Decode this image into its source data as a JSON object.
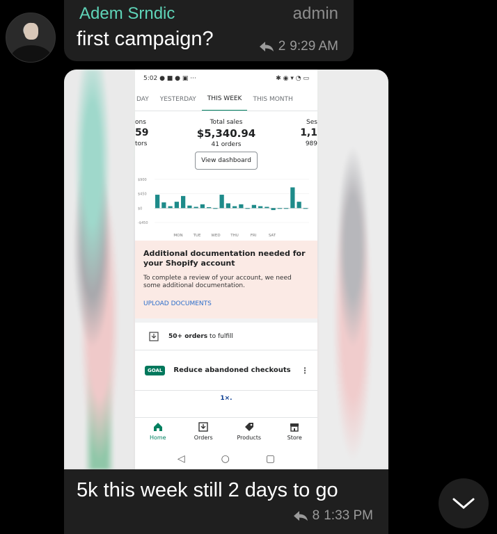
{
  "message1": {
    "sender": "Adem Srndic",
    "role": "admin",
    "text": "first campaign?",
    "reply_count": "2",
    "time": "9:29 AM"
  },
  "screenshot": {
    "status_time": "5:02",
    "tabs": [
      "DAY",
      "YESTERDAY",
      "THIS WEEK",
      "THIS MONTH"
    ],
    "active_tab": "THIS WEEK",
    "left_metric": {
      "label": "ons",
      "value": "59",
      "sub": "tors"
    },
    "total_sales": {
      "label": "Total sales",
      "value": "$5,340.94",
      "sub": "41 orders"
    },
    "right_metric": {
      "label": "Ses",
      "value": "1,1",
      "sub": "989"
    },
    "view_dashboard": "View dashboard",
    "chart_data": {
      "type": "bar",
      "y_ticks": [
        "$900",
        "$450",
        "$0",
        "-$450"
      ],
      "ylim": [
        -450,
        900
      ],
      "x_labels": [
        "MON",
        "TUE",
        "WED",
        "THU",
        "FRI",
        "SAT"
      ],
      "values": [
        420,
        180,
        60,
        200,
        380,
        80,
        40,
        120,
        30,
        0,
        420,
        150,
        60,
        120,
        0,
        100,
        60,
        40,
        -60,
        0,
        0,
        650,
        200,
        0
      ]
    },
    "notice": {
      "title": "Additional documentation needed for your Shopify account",
      "body": "To complete a review of your account, we need some additional documentation.",
      "link": "UPLOAD DOCUMENTS"
    },
    "orders_card": {
      "bold": "50+ orders",
      "rest": "to fulfill"
    },
    "goal": {
      "badge": "GOAL",
      "text": "Reduce abandoned checkouts",
      "more": "⋮"
    },
    "partial_text": "1×.",
    "nav": [
      {
        "label": "Home",
        "active": true
      },
      {
        "label": "Orders",
        "active": false
      },
      {
        "label": "Products",
        "active": false
      },
      {
        "label": "Store",
        "active": false
      }
    ]
  },
  "message2": {
    "text": "5k this week still 2 days to go",
    "reply_count": "8",
    "time": "1:33 PM"
  },
  "colors": {
    "accent": "#5fd4b8",
    "shopify_green": "#008060",
    "bubble": "#1f1f1f"
  }
}
